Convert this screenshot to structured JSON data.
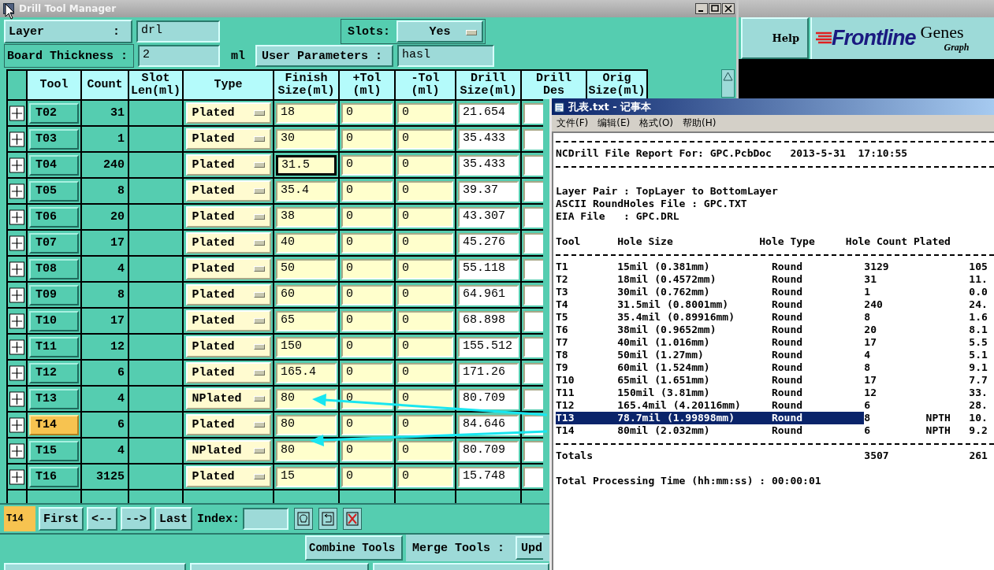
{
  "window": {
    "title": "Drill Tool Manager"
  },
  "layer": {
    "label": "Layer",
    "separator": ":",
    "value": "drl"
  },
  "slots": {
    "label": "Slots:",
    "value": "Yes"
  },
  "board_thickness": {
    "label": "Board Thickness :",
    "value": "2",
    "unit": "ml"
  },
  "user_parameters": {
    "label": "User Parameters :",
    "value": "hasl"
  },
  "table": {
    "columns": [
      "Tool",
      "Count",
      "Slot\nLen(ml)",
      "Type",
      "Finish\nSize(ml)",
      "+Tol\n(ml)",
      "-Tol\n(ml)",
      "Drill\nSize(ml)",
      "Drill\nDes",
      "Orig\nSize(ml)"
    ],
    "rows": [
      {
        "tool": "T02",
        "count": "31",
        "type": "Plated",
        "finish": "18",
        "plus_tol": "0",
        "minus_tol": "0",
        "drill_size": "21.654",
        "selected": false,
        "focused": false
      },
      {
        "tool": "T03",
        "count": "1",
        "type": "Plated",
        "finish": "30",
        "plus_tol": "0",
        "minus_tol": "0",
        "drill_size": "35.433",
        "selected": false,
        "focused": false
      },
      {
        "tool": "T04",
        "count": "240",
        "type": "Plated",
        "finish": "31.5",
        "plus_tol": "0",
        "minus_tol": "0",
        "drill_size": "35.433",
        "selected": false,
        "focused": true
      },
      {
        "tool": "T05",
        "count": "8",
        "type": "Plated",
        "finish": "35.4",
        "plus_tol": "0",
        "minus_tol": "0",
        "drill_size": "39.37",
        "selected": false,
        "focused": false
      },
      {
        "tool": "T06",
        "count": "20",
        "type": "Plated",
        "finish": "38",
        "plus_tol": "0",
        "minus_tol": "0",
        "drill_size": "43.307",
        "selected": false,
        "focused": false
      },
      {
        "tool": "T07",
        "count": "17",
        "type": "Plated",
        "finish": "40",
        "plus_tol": "0",
        "minus_tol": "0",
        "drill_size": "45.276",
        "selected": false,
        "focused": false
      },
      {
        "tool": "T08",
        "count": "4",
        "type": "Plated",
        "finish": "50",
        "plus_tol": "0",
        "minus_tol": "0",
        "drill_size": "55.118",
        "selected": false,
        "focused": false
      },
      {
        "tool": "T09",
        "count": "8",
        "type": "Plated",
        "finish": "60",
        "plus_tol": "0",
        "minus_tol": "0",
        "drill_size": "64.961",
        "selected": false,
        "focused": false
      },
      {
        "tool": "T10",
        "count": "17",
        "type": "Plated",
        "finish": "65",
        "plus_tol": "0",
        "minus_tol": "0",
        "drill_size": "68.898",
        "selected": false,
        "focused": false
      },
      {
        "tool": "T11",
        "count": "12",
        "type": "Plated",
        "finish": "150",
        "plus_tol": "0",
        "minus_tol": "0",
        "drill_size": "155.512",
        "selected": false,
        "focused": false
      },
      {
        "tool": "T12",
        "count": "6",
        "type": "Plated",
        "finish": "165.4",
        "plus_tol": "0",
        "minus_tol": "0",
        "drill_size": "171.26",
        "selected": false,
        "focused": false
      },
      {
        "tool": "T13",
        "count": "4",
        "type": "NPlated",
        "finish": "80",
        "plus_tol": "0",
        "minus_tol": "0",
        "drill_size": "80.709",
        "selected": false,
        "focused": false
      },
      {
        "tool": "T14",
        "count": "6",
        "type": "Plated",
        "finish": "80",
        "plus_tol": "0",
        "minus_tol": "0",
        "drill_size": "84.646",
        "selected": true,
        "focused": false
      },
      {
        "tool": "T15",
        "count": "4",
        "type": "NPlated",
        "finish": "80",
        "plus_tol": "0",
        "minus_tol": "0",
        "drill_size": "80.709",
        "selected": false,
        "focused": false
      },
      {
        "tool": "T16",
        "count": "3125",
        "type": "Plated",
        "finish": "15",
        "plus_tol": "0",
        "minus_tol": "0",
        "drill_size": "15.748",
        "selected": false,
        "focused": false
      }
    ]
  },
  "navigation": {
    "current": "T14",
    "buttons": [
      "First",
      "<--",
      "-->",
      "Last"
    ],
    "index_label": "Index:"
  },
  "actions": {
    "combine": "Combine Tools",
    "merge_label": "Merge Tools :",
    "merge_button": "Upd"
  },
  "side_panel": {
    "help": "Help",
    "brand": "Frontline",
    "product": "Genes",
    "tagline": "Graph"
  },
  "notepad": {
    "title": "孔表.txt - 记事本",
    "menu": [
      "文件(F)",
      "编辑(E)",
      "格式(O)",
      "帮助(H)"
    ],
    "report": {
      "header": "NCDrill File Report For: GPC.PcbDoc   2013-5-31  17:10:55",
      "info": [
        "Layer Pair : TopLayer to BottomLayer",
        "ASCII RoundHoles File : GPC.TXT",
        "EIA File   : GPC.DRL"
      ],
      "columns": [
        "Tool",
        "Hole Size",
        "Hole Type",
        "Hole Count Plated"
      ],
      "rows": [
        {
          "tool": "T1",
          "size": "15mil (0.381mm)",
          "type": "Round",
          "count": "3129",
          "plated": "105",
          "selected": false
        },
        {
          "tool": "T2",
          "size": "18mil (0.4572mm)",
          "type": "Round",
          "count": "31",
          "plated": "11.",
          "selected": false
        },
        {
          "tool": "T3",
          "size": "30mil (0.762mm)",
          "type": "Round",
          "count": "1",
          "plated": "0.0",
          "selected": false
        },
        {
          "tool": "T4",
          "size": "31.5mil (0.8001mm)",
          "type": "Round",
          "count": "240",
          "plated": "24.",
          "selected": false
        },
        {
          "tool": "T5",
          "size": "35.4mil (0.89916mm)",
          "type": "Round",
          "count": "8",
          "plated": "1.6",
          "selected": false
        },
        {
          "tool": "T6",
          "size": "38mil (0.9652mm)",
          "type": "Round",
          "count": "20",
          "plated": "8.1",
          "selected": false
        },
        {
          "tool": "T7",
          "size": "40mil (1.016mm)",
          "type": "Round",
          "count": "17",
          "plated": "5.5",
          "selected": false
        },
        {
          "tool": "T8",
          "size": "50mil (1.27mm)",
          "type": "Round",
          "count": "4",
          "plated": "5.1",
          "selected": false
        },
        {
          "tool": "T9",
          "size": "60mil (1.524mm)",
          "type": "Round",
          "count": "8",
          "plated": "9.1",
          "selected": false
        },
        {
          "tool": "T10",
          "size": "65mil (1.651mm)",
          "type": "Round",
          "count": "17",
          "plated": "7.7",
          "selected": false
        },
        {
          "tool": "T11",
          "size": "150mil (3.81mm)",
          "type": "Round",
          "count": "12",
          "plated": "33.",
          "selected": false
        },
        {
          "tool": "T12",
          "size": "165.4mil (4.20116mm)",
          "type": "Round",
          "count": "6",
          "plated": "28.",
          "selected": false
        },
        {
          "tool": "T13",
          "size": "78.7mil (1.99898mm)",
          "type": "Round",
          "count": "8",
          "note": "NPTH",
          "plated": "10.",
          "selected": true
        },
        {
          "tool": "T14",
          "size": "80mil (2.032mm)",
          "type": "Round",
          "count": "6",
          "note": "NPTH",
          "plated": "9.2",
          "selected": false
        }
      ],
      "totals": {
        "label": "Totals",
        "count": "3507",
        "plated": "261"
      },
      "footer": "Total Processing Time (hh:mm:ss) : 00:00:01"
    }
  }
}
